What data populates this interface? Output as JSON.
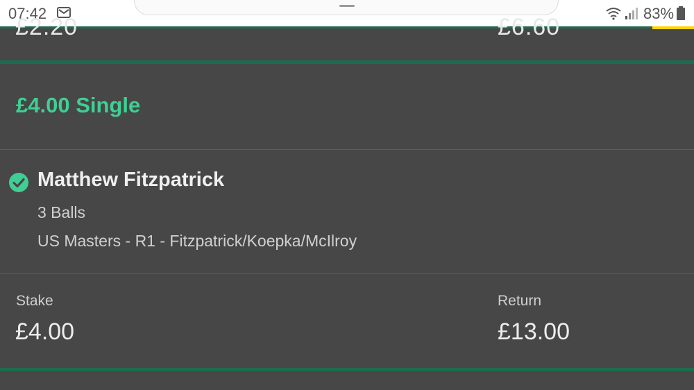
{
  "status_bar": {
    "time": "07:42",
    "battery": "83%"
  },
  "previous_bet": {
    "stake_value": "£2.20",
    "return_value": "£6.60"
  },
  "bet": {
    "title": "£4.00 Single",
    "selection": "Matthew Fitzpatrick",
    "market": "3 Balls",
    "event": "US Masters - R1 - Fitzpatrick/Koepka/McIlroy",
    "stake_label": "Stake",
    "stake_value": "£4.00",
    "return_label": "Return",
    "return_value": "£13.00"
  },
  "colors": {
    "accent_green": "#3fcf94",
    "divider_green": "#1f6b4f",
    "background": "#474747",
    "brand_yellow": "#ffd400"
  },
  "icons": {
    "mail": "mail-icon",
    "wifi": "wifi-icon",
    "signal": "signal-icon",
    "battery": "battery-icon",
    "status": "check-circle-icon"
  }
}
